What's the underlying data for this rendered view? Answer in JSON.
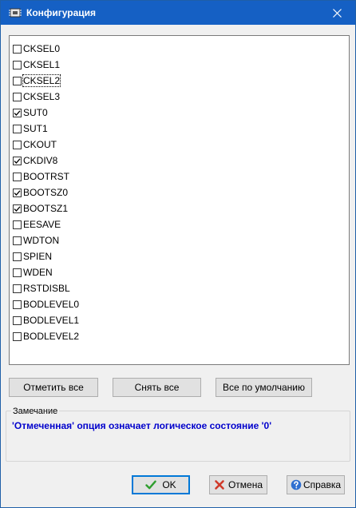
{
  "window": {
    "title": "Конфигурация"
  },
  "options": [
    {
      "label": "CKSEL0",
      "checked": false
    },
    {
      "label": "CKSEL1",
      "checked": false
    },
    {
      "label": "CKSEL2",
      "checked": false
    },
    {
      "label": "CKSEL3",
      "checked": false
    },
    {
      "label": "SUT0",
      "checked": true
    },
    {
      "label": "SUT1",
      "checked": false
    },
    {
      "label": "CKOUT",
      "checked": false
    },
    {
      "label": "CKDIV8",
      "checked": true
    },
    {
      "label": "BOOTRST",
      "checked": false
    },
    {
      "label": "BOOTSZ0",
      "checked": true
    },
    {
      "label": "BOOTSZ1",
      "checked": true
    },
    {
      "label": "EESAVE",
      "checked": false
    },
    {
      "label": "WDTON",
      "checked": false
    },
    {
      "label": "SPIEN",
      "checked": false
    },
    {
      "label": "WDEN",
      "checked": false
    },
    {
      "label": "RSTDISBL",
      "checked": false
    },
    {
      "label": "BODLEVEL0",
      "checked": false
    },
    {
      "label": "BODLEVEL1",
      "checked": false
    },
    {
      "label": "BODLEVEL2",
      "checked": false
    }
  ],
  "focused_option": "CKSEL2",
  "actions": {
    "check_all": "Отметить все",
    "uncheck_all": "Снять все",
    "defaults": "Все по умолчанию"
  },
  "note": {
    "legend": "Замечание",
    "text": "'Отмеченная' опция означает логическое состояние '0'"
  },
  "footer": {
    "ok": "OK",
    "cancel": "Отмена",
    "help": "Справка"
  },
  "colors": {
    "titlebar": "#1560c4",
    "note_text": "#0000cc",
    "ok_check": "#2e9e2e",
    "cancel_x": "#d03a2a",
    "help_icon": "#2f6fd0"
  },
  "icons": {
    "app": "chip-icon",
    "close": "close-icon",
    "ok": "checkmark-icon",
    "cancel": "red-x-icon",
    "help": "question-circle-icon"
  }
}
